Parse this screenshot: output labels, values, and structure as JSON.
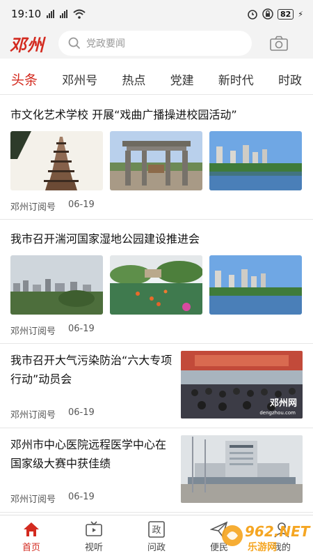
{
  "status": {
    "time": "19:10",
    "battery": "82"
  },
  "header": {
    "logo": "邓州",
    "search_placeholder": "党政要闻"
  },
  "tabs": [
    "头条",
    "邓州号",
    "热点",
    "党建",
    "新时代",
    "时政"
  ],
  "articles": [
    {
      "title": "市文化艺术学校 开展“戏曲广播操进校园活动”",
      "source": "邓州订阅号",
      "date": "06-19"
    },
    {
      "title": "我市召开湍河国家湿地公园建设推进会",
      "source": "邓州订阅号",
      "date": "06-19"
    },
    {
      "title": "我市召开大气污染防治“六大专项行动”动员会",
      "source": "邓州订阅号",
      "date": "06-19",
      "image_caption": "邓州网",
      "image_subcaption": "dengzhou.com"
    },
    {
      "title": "邓州市中心医院远程医学中心在国家级大赛中获佳绩",
      "source": "邓州订阅号",
      "date": "06-19"
    }
  ],
  "bottom_nav": [
    "首页",
    "视听",
    "问政",
    "便民",
    "我的"
  ],
  "watermark": {
    "brand": "962.NET",
    "sub": "乐游网"
  },
  "colors": {
    "accent": "#d32a1f"
  }
}
